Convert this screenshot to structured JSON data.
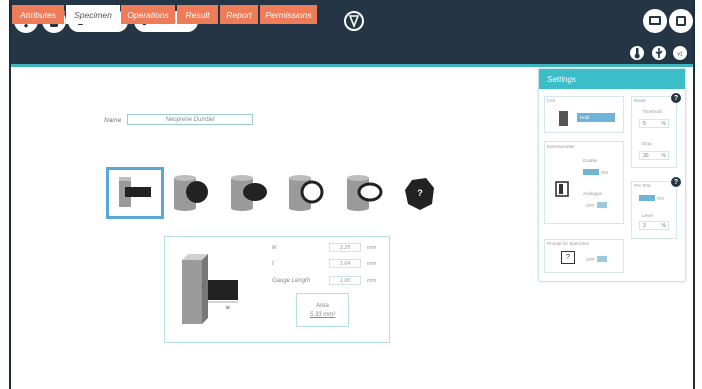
{
  "toolbar": {
    "force_value": "0.00",
    "force_unit": "N",
    "position_value": "0.00",
    "position_unit": "mm",
    "right_icons": [
      "monitor-icon",
      "chip-icon"
    ]
  },
  "tabs": [
    {
      "label": "Attributes",
      "active": false
    },
    {
      "label": "Specimen",
      "active": true
    },
    {
      "label": "Operations",
      "active": false
    },
    {
      "label": "Result",
      "active": false
    },
    {
      "label": "Report",
      "active": false
    },
    {
      "label": "Permissions",
      "active": false
    }
  ],
  "tab_icons": [
    "thermometer-icon",
    "usb-icon",
    "version-icon"
  ],
  "specimen": {
    "name_label": "Name",
    "name_value": "Neoprene Dumbel",
    "shapes": [
      "rectangular",
      "cylinder-full",
      "cylinder-ellipse",
      "tube-round",
      "tube-ellipse",
      "irregular"
    ],
    "irregular_glyph": "?",
    "dimensions": {
      "w_label": "w",
      "w_value": "3.25",
      "t_label": "t",
      "t_value": "1.64",
      "gauge_label": "Gauge Length",
      "gauge_value": "1.00",
      "unit": "mm",
      "diagram_t": "t",
      "diagram_w": "w"
    },
    "area_label": "Area",
    "area_value": "5.33 mm²"
  },
  "settings": {
    "title": "Settings",
    "load_label": "Cell",
    "load_value": "Hold",
    "extensometer_label": "Extensometer",
    "enable_label": "Enable",
    "enable_state": "ON",
    "analogue_label": "Analogue",
    "analogue_state": "OFF",
    "prompt_label": "Prompt for Specimen",
    "prompt_state": "OFF",
    "prompt_glyph": "?",
    "break_label": "Break",
    "threshold_label": "Threshold",
    "threshold_value": "5",
    "threshold_unit": "%",
    "drop_label": "Drop",
    "drop_value": "30",
    "drop_unit": "%",
    "pretest_label": "Pre Test",
    "pretest_state": "ON",
    "level_label": "Level",
    "level_value": "3",
    "level_unit": "%",
    "help_glyph": "?"
  },
  "colors": {
    "dark": "#243646",
    "accent": "#3cbdc8",
    "tab": "#ee7c58",
    "selected": "#5aa8d8"
  }
}
